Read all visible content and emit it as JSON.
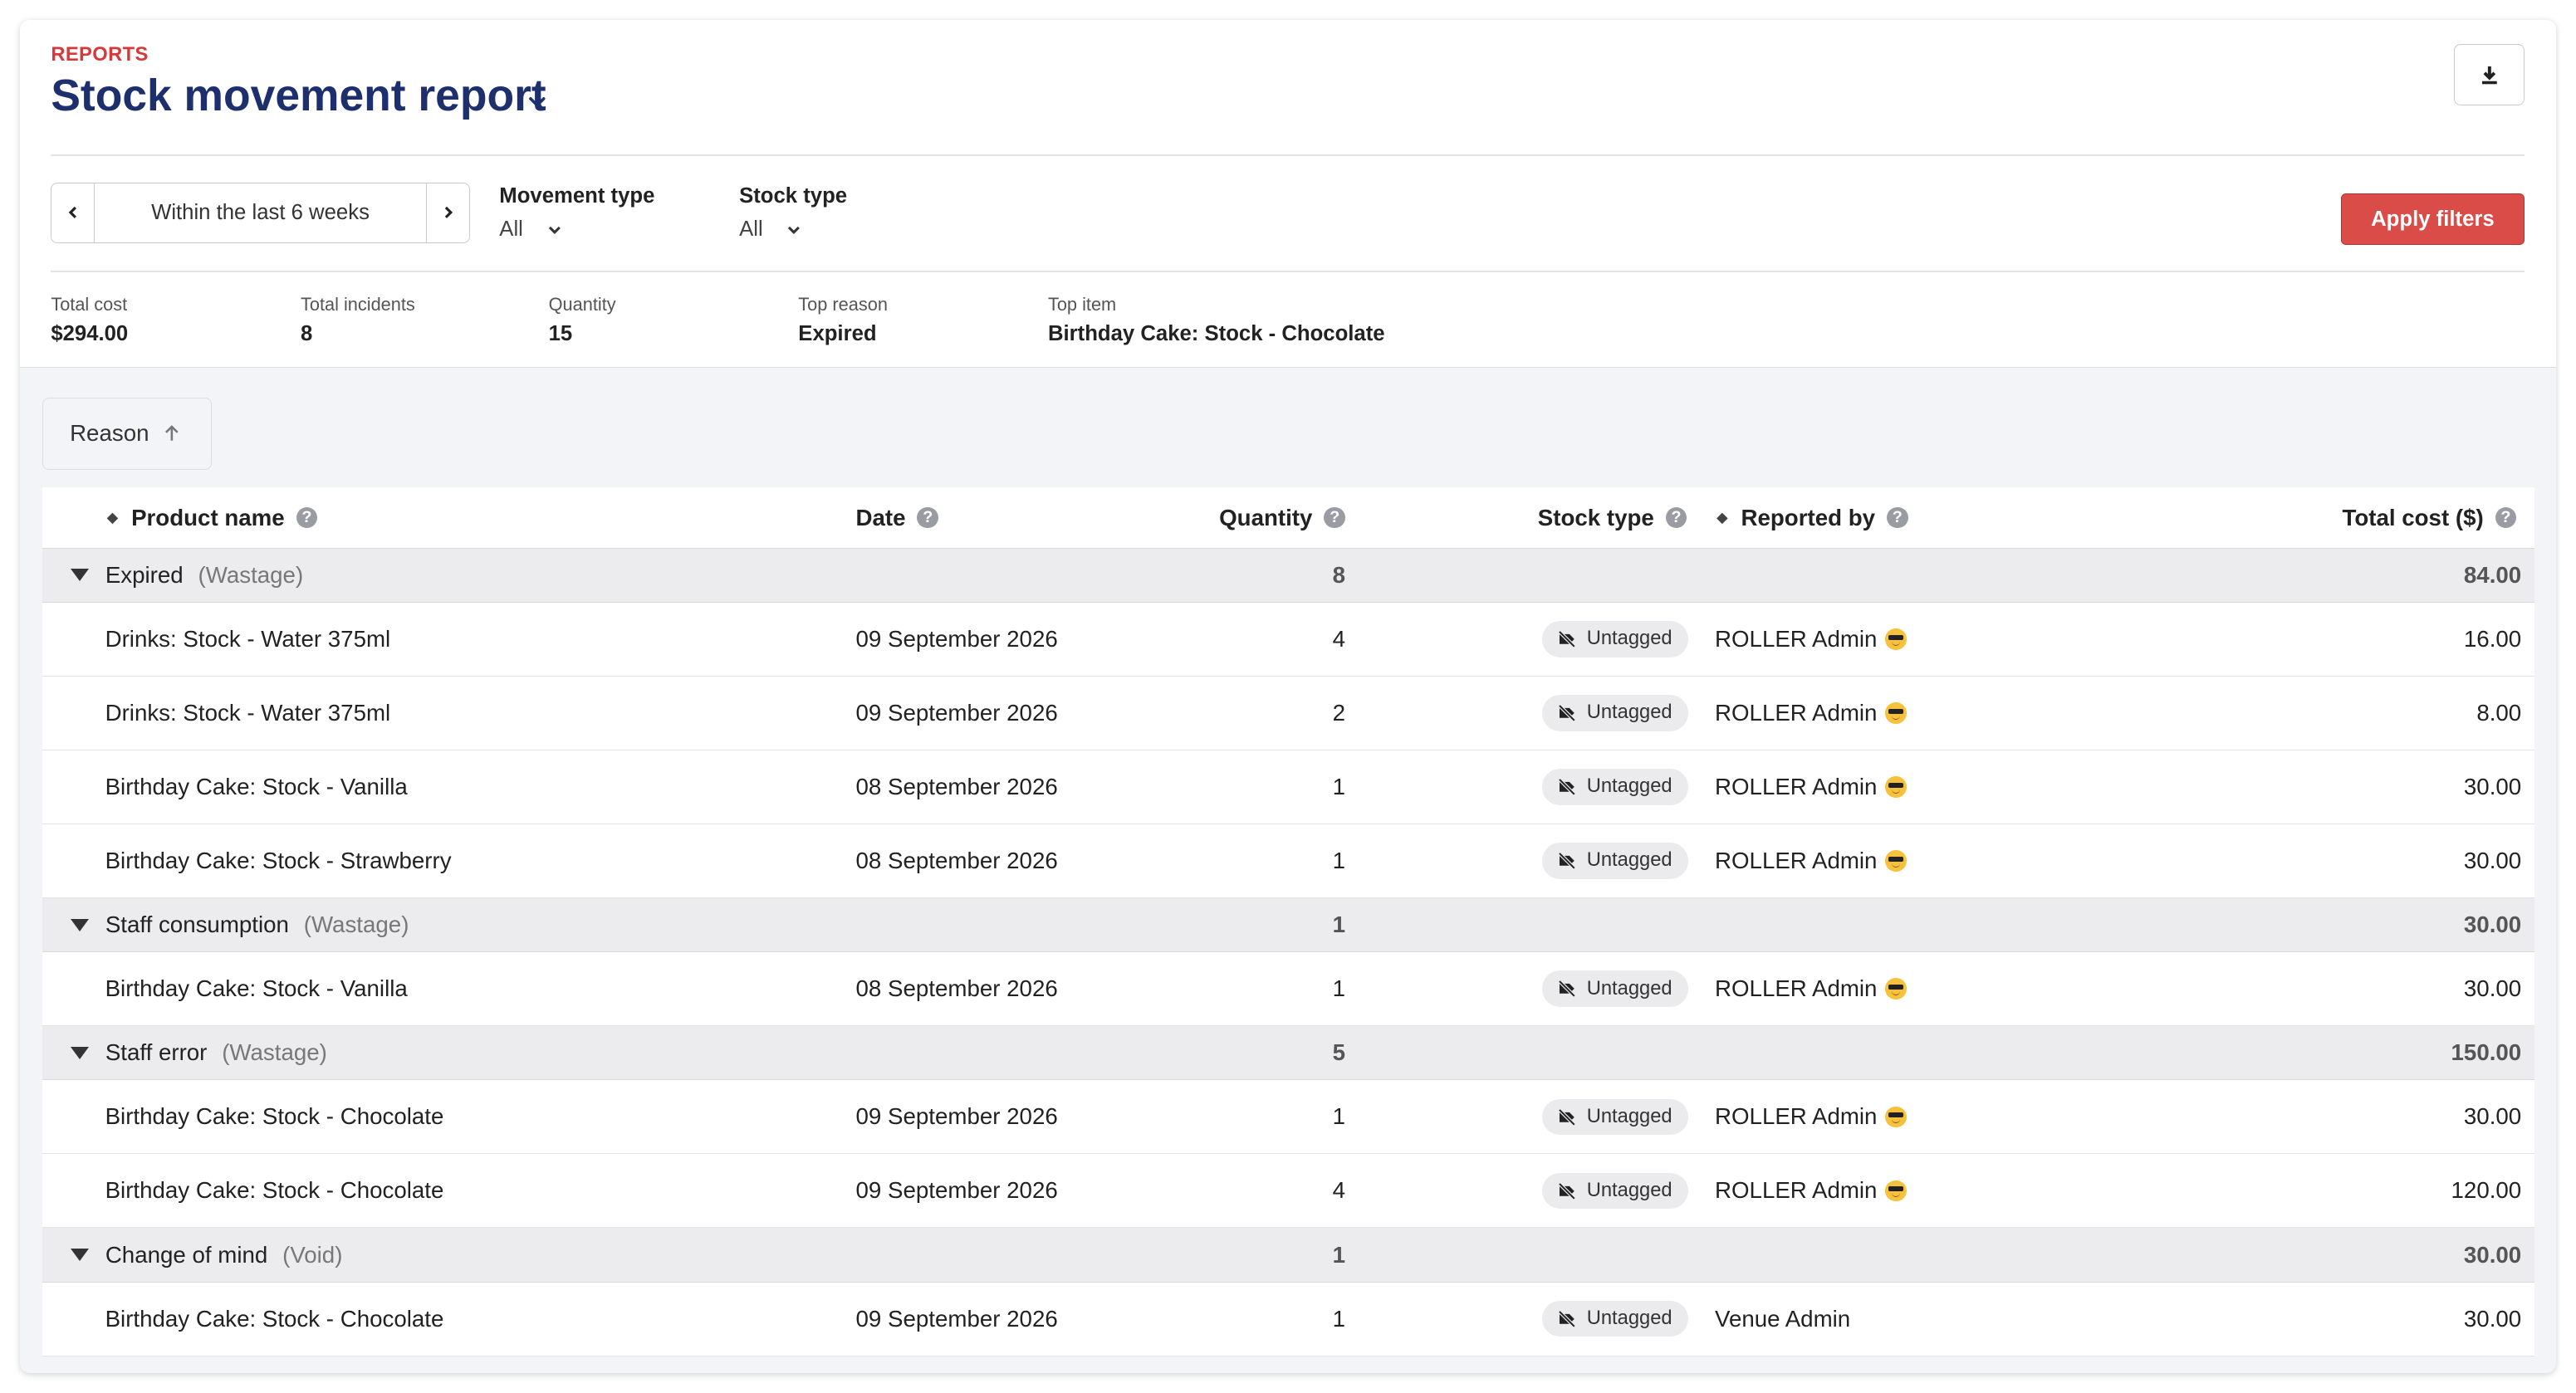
{
  "header": {
    "eyebrow": "REPORTS",
    "title": "Stock movement report"
  },
  "filters": {
    "date_range": "Within the last 6 weeks",
    "movement_type": {
      "label": "Movement type",
      "value": "All"
    },
    "stock_type": {
      "label": "Stock type",
      "value": "All"
    },
    "apply_label": "Apply filters"
  },
  "stats": [
    {
      "label": "Total cost",
      "value": "$294.00"
    },
    {
      "label": "Total incidents",
      "value": "8"
    },
    {
      "label": "Quantity",
      "value": "15"
    },
    {
      "label": "Top reason",
      "value": "Expired"
    },
    {
      "label": "Top item",
      "value": "Birthday Cake: Stock - Chocolate"
    }
  ],
  "grouping": {
    "label": "Reason"
  },
  "table": {
    "headers": {
      "product": "Product name",
      "date": "Date",
      "quantity": "Quantity",
      "stock_type": "Stock type",
      "reported_by": "Reported by",
      "total_cost": "Total cost ($)"
    },
    "groups": [
      {
        "name": "Expired",
        "type": "(Wastage)",
        "quantity": "8",
        "total": "84.00",
        "rows": [
          {
            "product": "Drinks: Stock - Water 375ml",
            "date": "09 September 2026",
            "quantity": "4",
            "tag": "Untagged",
            "reporter": "ROLLER Admin",
            "emoji": true,
            "total": "16.00"
          },
          {
            "product": "Drinks: Stock - Water 375ml",
            "date": "09 September 2026",
            "quantity": "2",
            "tag": "Untagged",
            "reporter": "ROLLER Admin",
            "emoji": true,
            "total": "8.00"
          },
          {
            "product": "Birthday Cake: Stock - Vanilla",
            "date": "08 September 2026",
            "quantity": "1",
            "tag": "Untagged",
            "reporter": "ROLLER Admin",
            "emoji": true,
            "total": "30.00"
          },
          {
            "product": "Birthday Cake: Stock - Strawberry",
            "date": "08 September 2026",
            "quantity": "1",
            "tag": "Untagged",
            "reporter": "ROLLER Admin",
            "emoji": true,
            "total": "30.00"
          }
        ]
      },
      {
        "name": "Staff consumption",
        "type": "(Wastage)",
        "quantity": "1",
        "total": "30.00",
        "rows": [
          {
            "product": "Birthday Cake: Stock - Vanilla",
            "date": "08 September 2026",
            "quantity": "1",
            "tag": "Untagged",
            "reporter": "ROLLER Admin",
            "emoji": true,
            "total": "30.00"
          }
        ]
      },
      {
        "name": "Staff error",
        "type": "(Wastage)",
        "quantity": "5",
        "total": "150.00",
        "rows": [
          {
            "product": "Birthday Cake: Stock - Chocolate",
            "date": "09 September 2026",
            "quantity": "1",
            "tag": "Untagged",
            "reporter": "ROLLER Admin",
            "emoji": true,
            "total": "30.00"
          },
          {
            "product": "Birthday Cake: Stock - Chocolate",
            "date": "09 September 2026",
            "quantity": "4",
            "tag": "Untagged",
            "reporter": "ROLLER Admin",
            "emoji": true,
            "total": "120.00"
          }
        ]
      },
      {
        "name": "Change of mind",
        "type": "(Void)",
        "quantity": "1",
        "total": "30.00",
        "rows": [
          {
            "product": "Birthday Cake: Stock - Chocolate",
            "date": "09 September 2026",
            "quantity": "1",
            "tag": "Untagged",
            "reporter": "Venue Admin",
            "emoji": false,
            "total": "30.00"
          }
        ]
      }
    ]
  },
  "colors": {
    "accent": "#d9383a",
    "title": "#1e2f6e",
    "apply_button": "#d94c47"
  }
}
